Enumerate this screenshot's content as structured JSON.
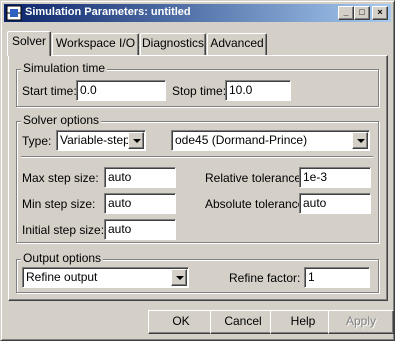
{
  "window": {
    "title": "Simulation Parameters: untitled",
    "minimize_glyph": "_",
    "maximize_glyph": "□",
    "close_glyph": "×"
  },
  "tabs": [
    {
      "label": "Solver",
      "active": true
    },
    {
      "label": "Workspace I/O",
      "active": false
    },
    {
      "label": "Diagnostics",
      "active": false
    },
    {
      "label": "Advanced",
      "active": false
    }
  ],
  "simulation_time": {
    "legend": "Simulation time",
    "start_label": "Start time:",
    "start_value": "0.0",
    "stop_label": "Stop time:",
    "stop_value": "10.0"
  },
  "solver_options": {
    "legend": "Solver options",
    "type_label": "Type:",
    "type_value": "Variable-step",
    "solver_value": "ode45 (Dormand-Prince)",
    "max_step_label": "Max step size:",
    "max_step_value": "auto",
    "min_step_label": "Min step size:",
    "min_step_value": "auto",
    "initial_step_label": "Initial step size:",
    "initial_step_value": "auto",
    "rel_tol_label": "Relative tolerance:",
    "rel_tol_value": "1e-3",
    "abs_tol_label": "Absolute tolerance:",
    "abs_tol_value": "auto"
  },
  "output_options": {
    "legend": "Output options",
    "output_value": "Refine output",
    "refine_label": "Refine factor:",
    "refine_value": "1"
  },
  "buttons": {
    "ok": "OK",
    "cancel": "Cancel",
    "help": "Help",
    "apply": "Apply"
  },
  "colors": {
    "titlebar_start": "#0a246a",
    "titlebar_end": "#a6caf0",
    "face": "#d4d0c8"
  },
  "icons": {
    "window_icon": "simulink-block-icon"
  }
}
